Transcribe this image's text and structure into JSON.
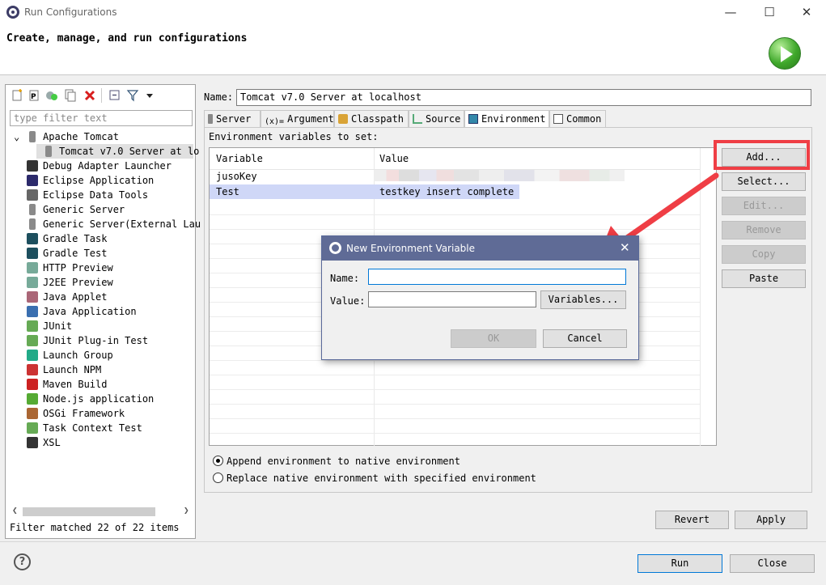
{
  "window": {
    "title": "Run Configurations",
    "min_icon": "minimize-icon",
    "max_icon": "maximize-icon",
    "close_icon": "close-icon"
  },
  "header": {
    "text": "Create, manage, and run configurations"
  },
  "left": {
    "filter_placeholder": "type filter text",
    "tree": [
      {
        "label": "Apache Tomcat",
        "icon": "tomcat-icon",
        "expanded": true
      },
      {
        "label": "Tomcat v7.0 Server at lo",
        "icon": "server-config-icon",
        "child": true,
        "selected": true
      },
      {
        "label": "Debug Adapter Launcher",
        "icon": "debug-adapter-icon"
      },
      {
        "label": "Eclipse Application",
        "icon": "eclipse-icon"
      },
      {
        "label": "Eclipse Data Tools",
        "icon": "data-tools-icon"
      },
      {
        "label": "Generic Server",
        "icon": "server-icon"
      },
      {
        "label": "Generic Server(External Lau",
        "icon": "server-icon"
      },
      {
        "label": "Gradle Task",
        "icon": "gradle-icon"
      },
      {
        "label": "Gradle Test",
        "icon": "gradle-icon"
      },
      {
        "label": "HTTP Preview",
        "icon": "preview-icon"
      },
      {
        "label": "J2EE Preview",
        "icon": "preview-icon"
      },
      {
        "label": "Java Applet",
        "icon": "applet-icon"
      },
      {
        "label": "Java Application",
        "icon": "java-app-icon"
      },
      {
        "label": "JUnit",
        "icon": "junit-icon"
      },
      {
        "label": "JUnit Plug-in Test",
        "icon": "junit-plugin-icon"
      },
      {
        "label": "Launch Group",
        "icon": "launch-group-icon"
      },
      {
        "label": "Launch NPM",
        "icon": "npm-icon"
      },
      {
        "label": "Maven Build",
        "icon": "maven-icon"
      },
      {
        "label": "Node.js application",
        "icon": "nodejs-icon"
      },
      {
        "label": "OSGi Framework",
        "icon": "osgi-icon"
      },
      {
        "label": "Task Context Test",
        "icon": "task-context-icon"
      },
      {
        "label": "XSL",
        "icon": "xsl-icon"
      }
    ],
    "status": "Filter matched 22 of 22 items"
  },
  "config": {
    "name_label": "Name:",
    "name_value": "Tomcat v7.0 Server at localhost",
    "tabs": [
      "Server",
      "Arguments",
      "Classpath",
      "Source",
      "Environment",
      "Common"
    ],
    "active_tab": "Environment",
    "env_label": "Environment variables to set:",
    "columns": [
      "Variable",
      "Value"
    ],
    "rows": [
      {
        "variable": "jusoKey",
        "value": ""
      },
      {
        "variable": "Test",
        "value": "testkey insert complete"
      }
    ],
    "buttons": {
      "add": "Add...",
      "select": "Select...",
      "edit": "Edit...",
      "remove": "Remove",
      "copy": "Copy",
      "paste": "Paste"
    },
    "append_label": "Append environment to native environment",
    "replace_label": "Replace native environment with specified environment",
    "revert": "Revert",
    "apply": "Apply"
  },
  "footer": {
    "run": "Run",
    "close": "Close"
  },
  "dialog": {
    "title": "New Environment Variable",
    "name_label": "Name:",
    "value_label": "Value:",
    "name_value": "",
    "value_value": "",
    "variables": "Variables...",
    "ok": "OK",
    "cancel": "Cancel"
  },
  "colors": {
    "annotation": "#ef3e45",
    "dialog_title": "#5f6b96",
    "selection": "#cce0ff"
  }
}
